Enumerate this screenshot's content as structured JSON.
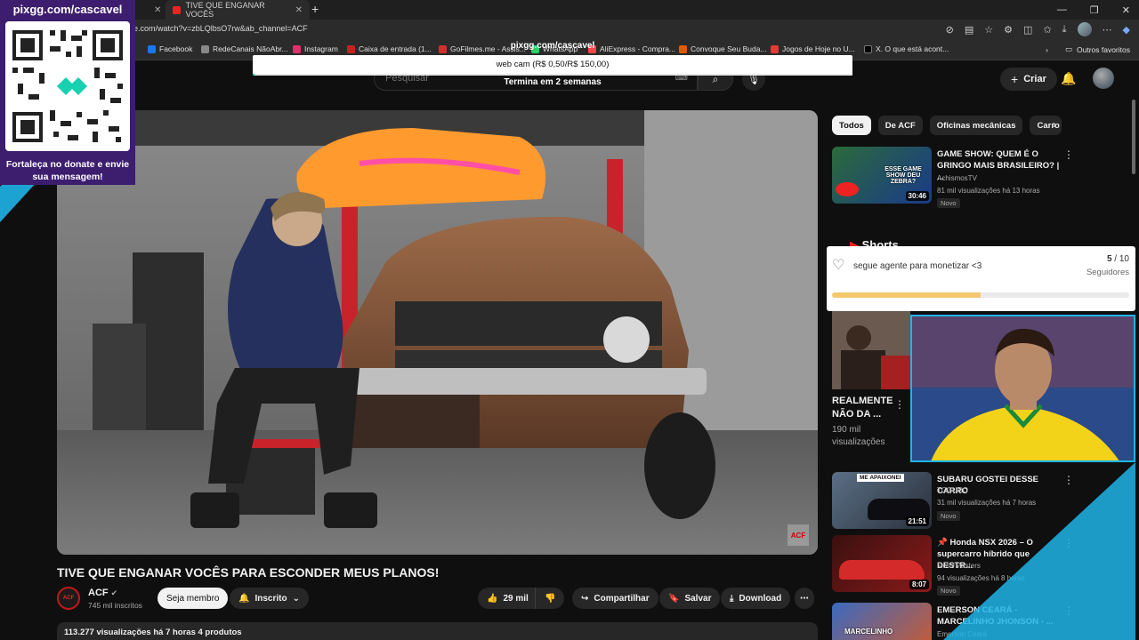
{
  "browser": {
    "tabs": [
      {
        "label": "TIVE QUE ENGANAR VOCÊS"
      }
    ],
    "new_tab": "+",
    "url": "e.com/watch?v=zbLQlbsO7rw&ab_channel=ACF",
    "window_controls": [
      "—",
      "❐",
      "✕"
    ],
    "bookmarks": [
      {
        "label": "Facebook",
        "color": "#1877f2"
      },
      {
        "label": "RedeCanais NãoAbr...",
        "color": "#888888"
      },
      {
        "label": "Instagram",
        "color": "#e1306c"
      },
      {
        "label": "Caixa de entrada (1...",
        "color": "#c5221f"
      },
      {
        "label": "GoFilmes.me - Assis...",
        "color": "#d32f2f"
      },
      {
        "label": "WhatsApp",
        "color": "#25d366"
      },
      {
        "label": "AliExpress - Compra...",
        "color": "#ff4747"
      },
      {
        "label": "Convoque Seu Buda...",
        "color": "#e05a00"
      },
      {
        "label": "Jogos de Hoje no U...",
        "color": "#e53935"
      },
      {
        "label": "X. O que está acont...",
        "color": "#000000"
      }
    ],
    "bookmarks_more": "Outros favoritos"
  },
  "overlay": {
    "donate_url": "pixgg.com/cascavel",
    "donate_message": "Fortaleça no donate e envie sua mensagem!",
    "goal_url": "pixgg.com/cascavel",
    "goal_title": "web cam (R$ 0,50/R$ 150,00)",
    "goal_progress": 0.0033,
    "goal_subtitle": "Termina em 2 semanas",
    "follower_goal_label": "segue agente para monetizar <3",
    "follower_current": "5",
    "follower_total": " / 10",
    "follower_unit": "Seguidores",
    "follower_progress": 0.5
  },
  "header": {
    "search_placeholder": "Pesquisar",
    "create_label": "Criar"
  },
  "video": {
    "watermark": "ACF",
    "title": "TIVE QUE ENGANAR VOCÊS PARA ESCONDER MEUS PLANOS!",
    "channel": "ACF",
    "channel_subs": "745 mil inscritos",
    "member_label": "Seja membro",
    "subscribed_label": "Inscrito",
    "likes": "29 mil",
    "share_label": "Compartilhar",
    "save_label": "Salvar",
    "download_label": "Download",
    "views_line": "113.277 visualizações  há 7 horas  4 produtos"
  },
  "sidebar": {
    "chips": [
      "Todos",
      "De ACF",
      "Oficinas mecânicas",
      "Carro"
    ],
    "recs": [
      {
        "title": "GAME SHOW: QUEM É O GRINGO MAIS BRASILEIRO? | ...",
        "channel": "AchismosTV",
        "meta": "81 mil visualizações  há 13 horas",
        "badge": "Novo",
        "duration": "30:46",
        "thumb_text": "ESSE GAME SHOW DEU ZEBRA?"
      },
      {
        "title": "SUBARU GOSTEI DESSE CARRO",
        "channel": "TOGURO",
        "meta": "31 mil visualizações  há 7 horas",
        "badge": "Novo",
        "duration": "21:51",
        "thumb_text": "ME APAIXONEI"
      },
      {
        "title": "📌 Honda NSX 2026 – O supercarro híbrido que DESTR...",
        "channel": "MotorMasters",
        "meta": "94 visualizações  há 8 horas",
        "badge": "Novo",
        "duration": "8:07",
        "thumb_text": ""
      },
      {
        "title": "EMERSON CEARÁ - MARCELINHO JHONSON - ...",
        "channel": "Emerson Ceará",
        "meta": "",
        "badge": "",
        "duration": "",
        "thumb_text": "MARCELINHO"
      }
    ],
    "shorts_title": "Shorts",
    "short": {
      "title": "REALMENTE NÃO DA ...",
      "views": "190 mil visualizações"
    }
  }
}
